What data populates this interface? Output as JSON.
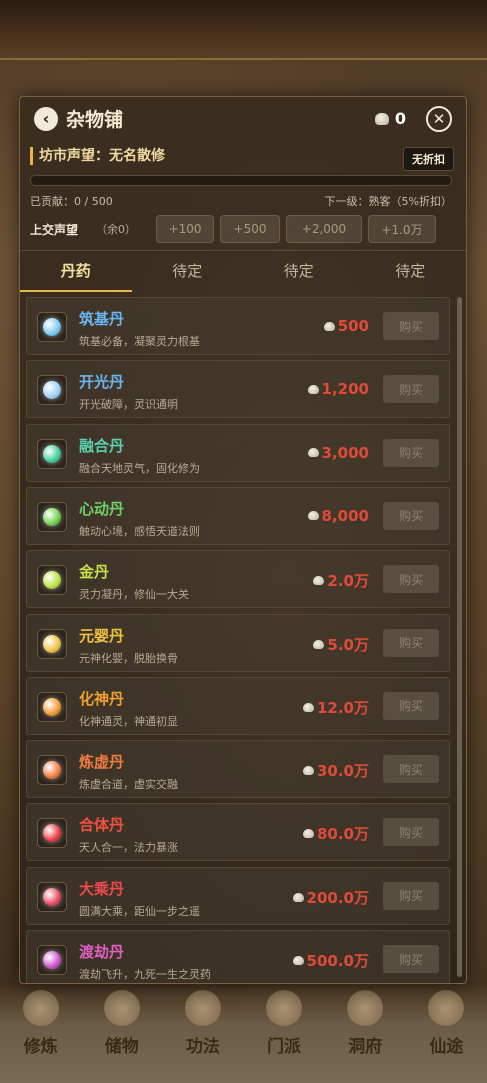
{
  "background": {
    "nav": [
      "修炼",
      "储物",
      "功法",
      "门派",
      "洞府",
      "仙途"
    ]
  },
  "header": {
    "back_icon": "chevron-left-icon",
    "title": "杂物铺",
    "coin_count": "0",
    "close_icon": "close-icon"
  },
  "reputation": {
    "label": "坊市声望：无名散修",
    "badge": "无折扣",
    "progress": 0,
    "contributed": "已贡献：0 / 500",
    "next_level": "下一级：熟客（5%折扣）"
  },
  "submit": {
    "label": "上交声望",
    "remaining": "（余0）",
    "amounts": [
      "+100",
      "+500",
      "+2,000",
      "+1.0万"
    ]
  },
  "tabs": [
    "丹药",
    "待定",
    "待定",
    "待定"
  ],
  "buy_label": "购买",
  "items": [
    {
      "name": "筑基丹",
      "desc": "筑基必备，凝聚灵力根基",
      "price": "500",
      "name_color": "#6ab4f0",
      "orb_color": "#7ac8f0"
    },
    {
      "name": "开光丹",
      "desc": "开光破障，灵识通明",
      "price": "1,200",
      "name_color": "#6ab4f0",
      "orb_color": "#9ad0ff"
    },
    {
      "name": "融合丹",
      "desc": "融合天地灵气，固化修为",
      "price": "3,000",
      "name_color": "#5ad0b0",
      "orb_color": "#3ecf9a"
    },
    {
      "name": "心动丹",
      "desc": "触动心境，感悟天道法则",
      "price": "8,000",
      "name_color": "#6fd06a",
      "orb_color": "#6fd04a"
    },
    {
      "name": "金丹",
      "desc": "灵力凝丹，修仙一大关",
      "price": "2.0万",
      "name_color": "#c6e04a",
      "orb_color": "#b8e040"
    },
    {
      "name": "元婴丹",
      "desc": "元神化婴，脱胎换骨",
      "price": "5.0万",
      "name_color": "#f0c040",
      "orb_color": "#f0c040"
    },
    {
      "name": "化神丹",
      "desc": "化神通灵，神通初显",
      "price": "12.0万",
      "name_color": "#f0a030",
      "orb_color": "#f09a30"
    },
    {
      "name": "炼虚丹",
      "desc": "炼虚合道，虚实交融",
      "price": "30.0万",
      "name_color": "#f07a40",
      "orb_color": "#f07a40"
    },
    {
      "name": "合体丹",
      "desc": "天人合一，法力暴涨",
      "price": "80.0万",
      "name_color": "#f05040",
      "orb_color": "#ee3a40"
    },
    {
      "name": "大乘丹",
      "desc": "圆满大乘，距仙一步之遥",
      "price": "200.0万",
      "name_color": "#f04a50",
      "orb_color": "#e84a60"
    },
    {
      "name": "渡劫丹",
      "desc": "渡劫飞升，九死一生之灵药",
      "price": "500.0万",
      "name_color": "#e060c0",
      "orb_color": "#d050d0"
    }
  ]
}
